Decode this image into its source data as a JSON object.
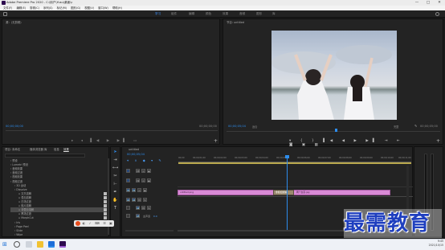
{
  "window": {
    "title": "Adobe Premiere Pro 2020 - C:\\用户\\Yusu\\桌面\\c",
    "minimize": "—",
    "maximize": "□",
    "close": "✕"
  },
  "menu": [
    "文件(F)",
    "编辑(E)",
    "剪辑(C)",
    "序列(S)",
    "标记(M)",
    "图形(G)",
    "视图(V)",
    "窗口(W)",
    "帮助(H)"
  ],
  "workspaces": [
    "学习",
    "组件",
    "编辑",
    "颜色",
    "效果",
    "音频",
    "图形",
    "库"
  ],
  "active_workspace": 0,
  "source_panel": {
    "tab": "源：(无剪辑)",
    "timecode_left": "00;00;00;00",
    "timecode_right": "00;00;00;00"
  },
  "program_panel": {
    "tab": "节目: untitled",
    "timecode": "00;00;05;04",
    "fit": "适合",
    "quality": "完整",
    "duration": "00;00;05;00"
  },
  "project_panel": {
    "tabs": [
      "项目: 未命名",
      "媒体浏览器",
      "库",
      "信息",
      "效果"
    ],
    "active_tab": 4
  },
  "effects_list": [
    {
      "label": "预设",
      "indent": 0,
      "checkbox": false
    },
    {
      "label": "Lumetri 预设",
      "indent": 0,
      "checkbox": false
    },
    {
      "label": "音频效果",
      "indent": 0,
      "checkbox": false
    },
    {
      "label": "音频过渡",
      "indent": 0,
      "checkbox": false
    },
    {
      "label": "视频效果",
      "indent": 0,
      "checkbox": false
    },
    {
      "label": "视频过渡",
      "indent": 0,
      "checkbox": false
    },
    {
      "label": "3D 运动",
      "indent": 1,
      "checkbox": false
    },
    {
      "label": "Dissolve",
      "indent": 1,
      "checkbox": false
    },
    {
      "label": "交叉溶解",
      "indent": 2,
      "checkbox": true
    },
    {
      "label": "叠加溶解",
      "indent": 2,
      "checkbox": true
    },
    {
      "label": "白场过渡",
      "indent": 2,
      "checkbox": true
    },
    {
      "label": "胶片溶解",
      "indent": 2,
      "checkbox": true
    },
    {
      "label": "非叠加溶解",
      "indent": 2,
      "checkbox": true,
      "selected": true
    },
    {
      "label": "黑场过渡",
      "indent": 2,
      "checkbox": true
    },
    {
      "label": "MorphCut",
      "indent": 2,
      "checkbox": true
    },
    {
      "label": "Iris",
      "indent": 1,
      "checkbox": false
    },
    {
      "label": "Page Peel",
      "indent": 1,
      "checkbox": false
    },
    {
      "label": "Slide",
      "indent": 1,
      "checkbox": false
    },
    {
      "label": "Wipe",
      "indent": 1,
      "checkbox": false
    }
  ],
  "timeline": {
    "tab": "untitled",
    "timecode": "00;00;05;04",
    "ruler": [
      "00;00",
      "00;00;01;00",
      "00;00;02;00",
      "00;00;03;00",
      "00;00;04;00",
      "00;00;05;00",
      "00;00;06;00",
      "00;00;07;00",
      "00;00;08;00",
      "00;00;09;00",
      "00;00;10;00",
      "00;00;11;00"
    ],
    "video_tracks": [
      "V3",
      "V2",
      "V1"
    ],
    "audio_tracks": [
      "A1",
      "A2",
      "A3"
    ],
    "master": "主声道",
    "master_level": "0.0",
    "clips": [
      {
        "name": "untitled.png",
        "track": "V1"
      },
      {
        "name": "非叠加溶解",
        "track": "V1",
        "transition": true
      },
      {
        "name": "两个女孩.jpg",
        "track": "V1"
      }
    ]
  },
  "taskbar": {
    "time": "9:45",
    "date": "2021/10/15"
  },
  "watermark": "最需教育",
  "colors": {
    "accent": "#2d8ceb",
    "clip": "#d98ad6",
    "transition": "#9a8a6e",
    "watermark": "#1f3fbf"
  }
}
